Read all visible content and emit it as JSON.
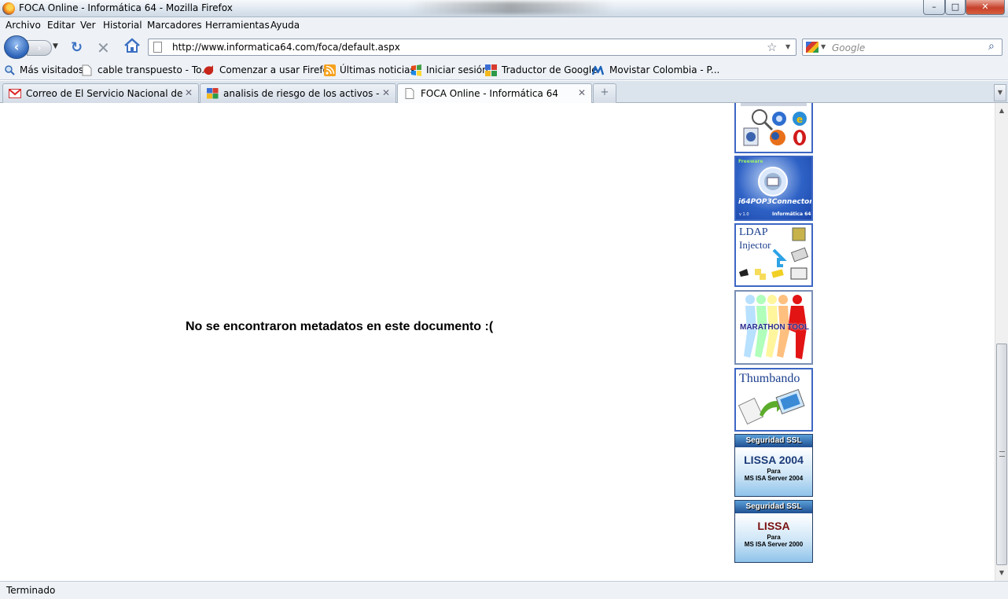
{
  "window": {
    "title": "FOCA Online - Informática 64 - Mozilla Firefox",
    "minimize_label": "–",
    "maximize_label": "□",
    "close_label": "✕"
  },
  "menu": {
    "items": [
      {
        "label": "Archivo"
      },
      {
        "label": "Editar"
      },
      {
        "label": "Ver"
      },
      {
        "label": "Historial"
      },
      {
        "label": "Marcadores"
      },
      {
        "label": "Herramientas"
      },
      {
        "label": "Ayuda"
      }
    ]
  },
  "navbar": {
    "url": "http://www.informatica64.com/foca/default.aspx",
    "search_placeholder": "Google",
    "back_glyph": "‹",
    "forward_glyph": "›"
  },
  "bookmarks": {
    "items": [
      {
        "label": "Más visitados",
        "icon": "most-visited-icon"
      },
      {
        "label": "cable transpuesto - To...",
        "icon": "page-icon"
      },
      {
        "label": "Comenzar a usar Firefox",
        "icon": "firefox-icon"
      },
      {
        "label": "Últimas noticias",
        "icon": "rss-icon"
      },
      {
        "label": "Iniciar sesión",
        "icon": "windows-live-icon"
      },
      {
        "label": "Traductor de Google",
        "icon": "google-icon"
      },
      {
        "label": "Movistar Colombia - P...",
        "icon": "movistar-icon"
      }
    ]
  },
  "tabs": [
    {
      "label": "Correo de El Servicio Nacional de A...",
      "icon": "gmail-icon",
      "active": false
    },
    {
      "label": "analisis de riesgo de los activos - Bu...",
      "icon": "google-icon",
      "active": false
    },
    {
      "label": "FOCA Online - Informática 64",
      "icon": "page-icon",
      "active": true
    }
  ],
  "content": {
    "message": "No se encontraron metadatos en este documento :(",
    "banners": {
      "popconnector": {
        "tag": "Freeware",
        "name": "i64POP3Connector",
        "brand": "Informática 64",
        "version": "v 1.0"
      },
      "ldap": {
        "line1": "LDAP",
        "line2": "Injector"
      },
      "marathon": {
        "name": "MARATHON TOOL"
      },
      "thumbando": {
        "name": "Thumbando"
      },
      "lissa_2004": {
        "header": "Seguridad SSL",
        "title": "LISSA 2004",
        "para": "Para",
        "sub": "MS ISA Server 2004",
        "title_color": "#1a3a78"
      },
      "lissa_2000": {
        "header": "Seguridad SSL",
        "title": "LISSA",
        "para": "Para",
        "sub": "MS ISA Server 2000",
        "title_color": "#7a1010"
      }
    }
  },
  "status": {
    "text": "Terminado"
  }
}
